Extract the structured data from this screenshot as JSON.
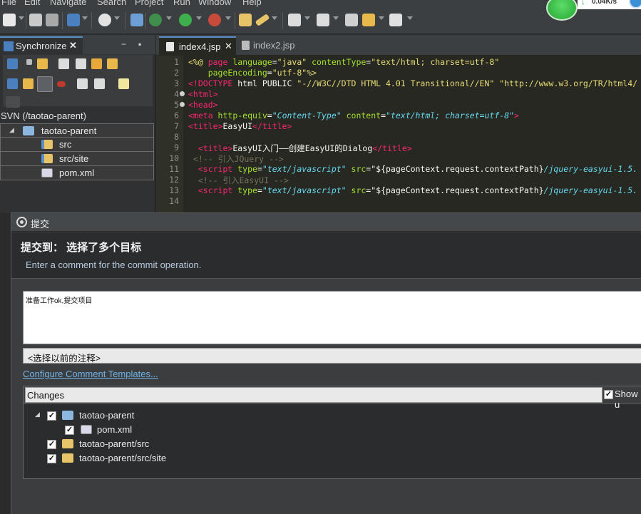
{
  "menu": {
    "items": [
      "File",
      "Edit",
      "Navigate",
      "Search",
      "Project",
      "Run",
      "Window",
      "Help"
    ]
  },
  "net_widget": {
    "speed": "0.04K/s",
    "arrow": "↓"
  },
  "left_panel": {
    "tab_label": "Synchronize",
    "close_glyph": "✕",
    "min_glyph": "−",
    "max_glyph": "▪",
    "title": "SVN (/taotao-parent)",
    "tree": [
      {
        "label": "taotao-parent",
        "icon": "project-folder-icon",
        "expanded": true
      },
      {
        "label": "src",
        "icon": "package-folder-icon"
      },
      {
        "label": "src/site",
        "icon": "package-folder-icon"
      },
      {
        "label": "pom.xml",
        "icon": "xml-file-icon"
      }
    ]
  },
  "editor": {
    "tabs": [
      {
        "label": "index4.jsp",
        "active": true,
        "close": "✕"
      },
      {
        "label": "index2.jsp",
        "active": false
      }
    ],
    "line_numbers": [
      "1",
      "2",
      "3",
      "4",
      "5",
      "6",
      "7",
      "8",
      "9",
      "10",
      "11",
      "12",
      "13",
      "14"
    ],
    "code": {
      "l1_a": "<%@ ",
      "l1_b": "page",
      "l1_c": " language",
      "l1_d": "=",
      "l1_e": "\"java\"",
      "l1_f": " contentType",
      "l1_g": "=",
      "l1_h": "\"text/html; charset=utf-8\"",
      "l2_a": "    pageEncoding",
      "l2_b": "=",
      "l2_c": "\"utf-8\"",
      "l2_d": "%>",
      "l3_a": "<!DOCTYPE ",
      "l3_b": "html PUBLIC ",
      "l3_c": "\"-//W3C//DTD HTML 4.01 Transitional//EN\"",
      "l3_d": " ",
      "l3_e": "\"http://www.w3.org/TR/html4/",
      "l4": "<html>",
      "l5": "<head>",
      "l6_a": "<meta ",
      "l6_b": "http-equiv",
      "l6_c": "=",
      "l6_d": "\"Content-Type\"",
      "l6_e": " content",
      "l6_f": "=",
      "l6_g": "\"text/html; charset=utf-8\"",
      "l6_h": ">",
      "l7_a": "<title>",
      "l7_b": "EasyUI",
      "l7_c": "</title>",
      "l9_a": "  <title>",
      "l9_b": "EasyUI入门——创建EasyUI的Dialog",
      "l9_c": "</title>",
      "l10": " <!-- 引入JQuery -->",
      "l11_a": "  <script ",
      "l11_b": "type",
      "l11_c": "=",
      "l11_d": "\"text/javascript\"",
      "l11_e": " src",
      "l11_f": "=",
      "l11_g": "\"${pageContext.request.contextPath}",
      "l11_h": "/jquery-easyui-1.5.",
      "l12": "  <!-- 引入EasyUI -->",
      "l13_a": "  <script ",
      "l13_b": "type",
      "l13_c": "=",
      "l13_d": "\"text/javascript\"",
      "l13_e": " src",
      "l13_f": "=",
      "l13_g": "\"${pageContext.request.contextPath}",
      "l13_h": "/jquery-easyui-1.5."
    }
  },
  "dialog": {
    "title": "提交",
    "heading": "提交到： 选择了多个目标",
    "subtitle": "Enter a comment for the commit operation.",
    "comment": "准备工作ok,提交项目",
    "previous_comments": "<选择以前的注释>",
    "configure_link": "Configure Comment Templates...",
    "changes_header": "Changes",
    "show_label": "Show u",
    "check_glyph": "✓",
    "changes": [
      {
        "label": "taotao-parent",
        "icon": "project-folder-icon",
        "checked": true
      },
      {
        "label": "pom.xml",
        "icon": "xml-file-icon",
        "checked": true
      },
      {
        "label": "taotao-parent/src",
        "icon": "folder-icon",
        "checked": true
      },
      {
        "label": "taotao-parent/src/site",
        "icon": "folder-icon",
        "checked": true
      }
    ]
  }
}
